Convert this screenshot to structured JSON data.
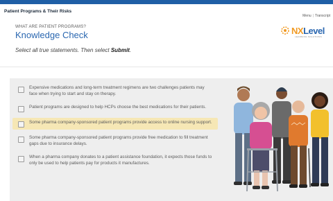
{
  "header": {
    "course_title": "Patient Programs & Their Risks",
    "menu_link": "Menu",
    "transcript_link": "Transcript"
  },
  "slide": {
    "kicker": "WHAT ARE PATIENT PROGRAMS?",
    "title": "Knowledge Check",
    "instructions_prefix": "Select all true statements. Then select ",
    "instructions_action": "Submit",
    "instructions_suffix": "."
  },
  "logo": {
    "text_nx": "NX",
    "text_level": "Level",
    "tagline": "LEARNING SOLUTIONS",
    "colors": {
      "orange": "#f19a22",
      "blue": "#2a67b0"
    }
  },
  "options": [
    {
      "text": "Expensive medications and long-term treatment regimens are two challenges patients may face when trying to start and stay on therapy.",
      "checked": false,
      "highlighted": false
    },
    {
      "text": "Patient programs are designed to help HCPs choose the best medications for their patients.",
      "checked": false,
      "highlighted": false
    },
    {
      "text": "Some pharma company-sponsored patient programs provide access to online nursing support.",
      "checked": false,
      "highlighted": true
    },
    {
      "text": "Some pharma company-sponsored patient programs provide free medication to fill treatment gaps due to insurance delays.",
      "checked": false,
      "highlighted": false
    },
    {
      "text": "When a pharma company donates to a patient assistance foundation, it expects those funds to only be used to help patients pay for products it manufactures.",
      "checked": false,
      "highlighted": false
    }
  ],
  "colors": {
    "accent_blue": "#2a67b0",
    "highlight": "#f6e7b5",
    "panel_bg": "#eeeeee"
  }
}
